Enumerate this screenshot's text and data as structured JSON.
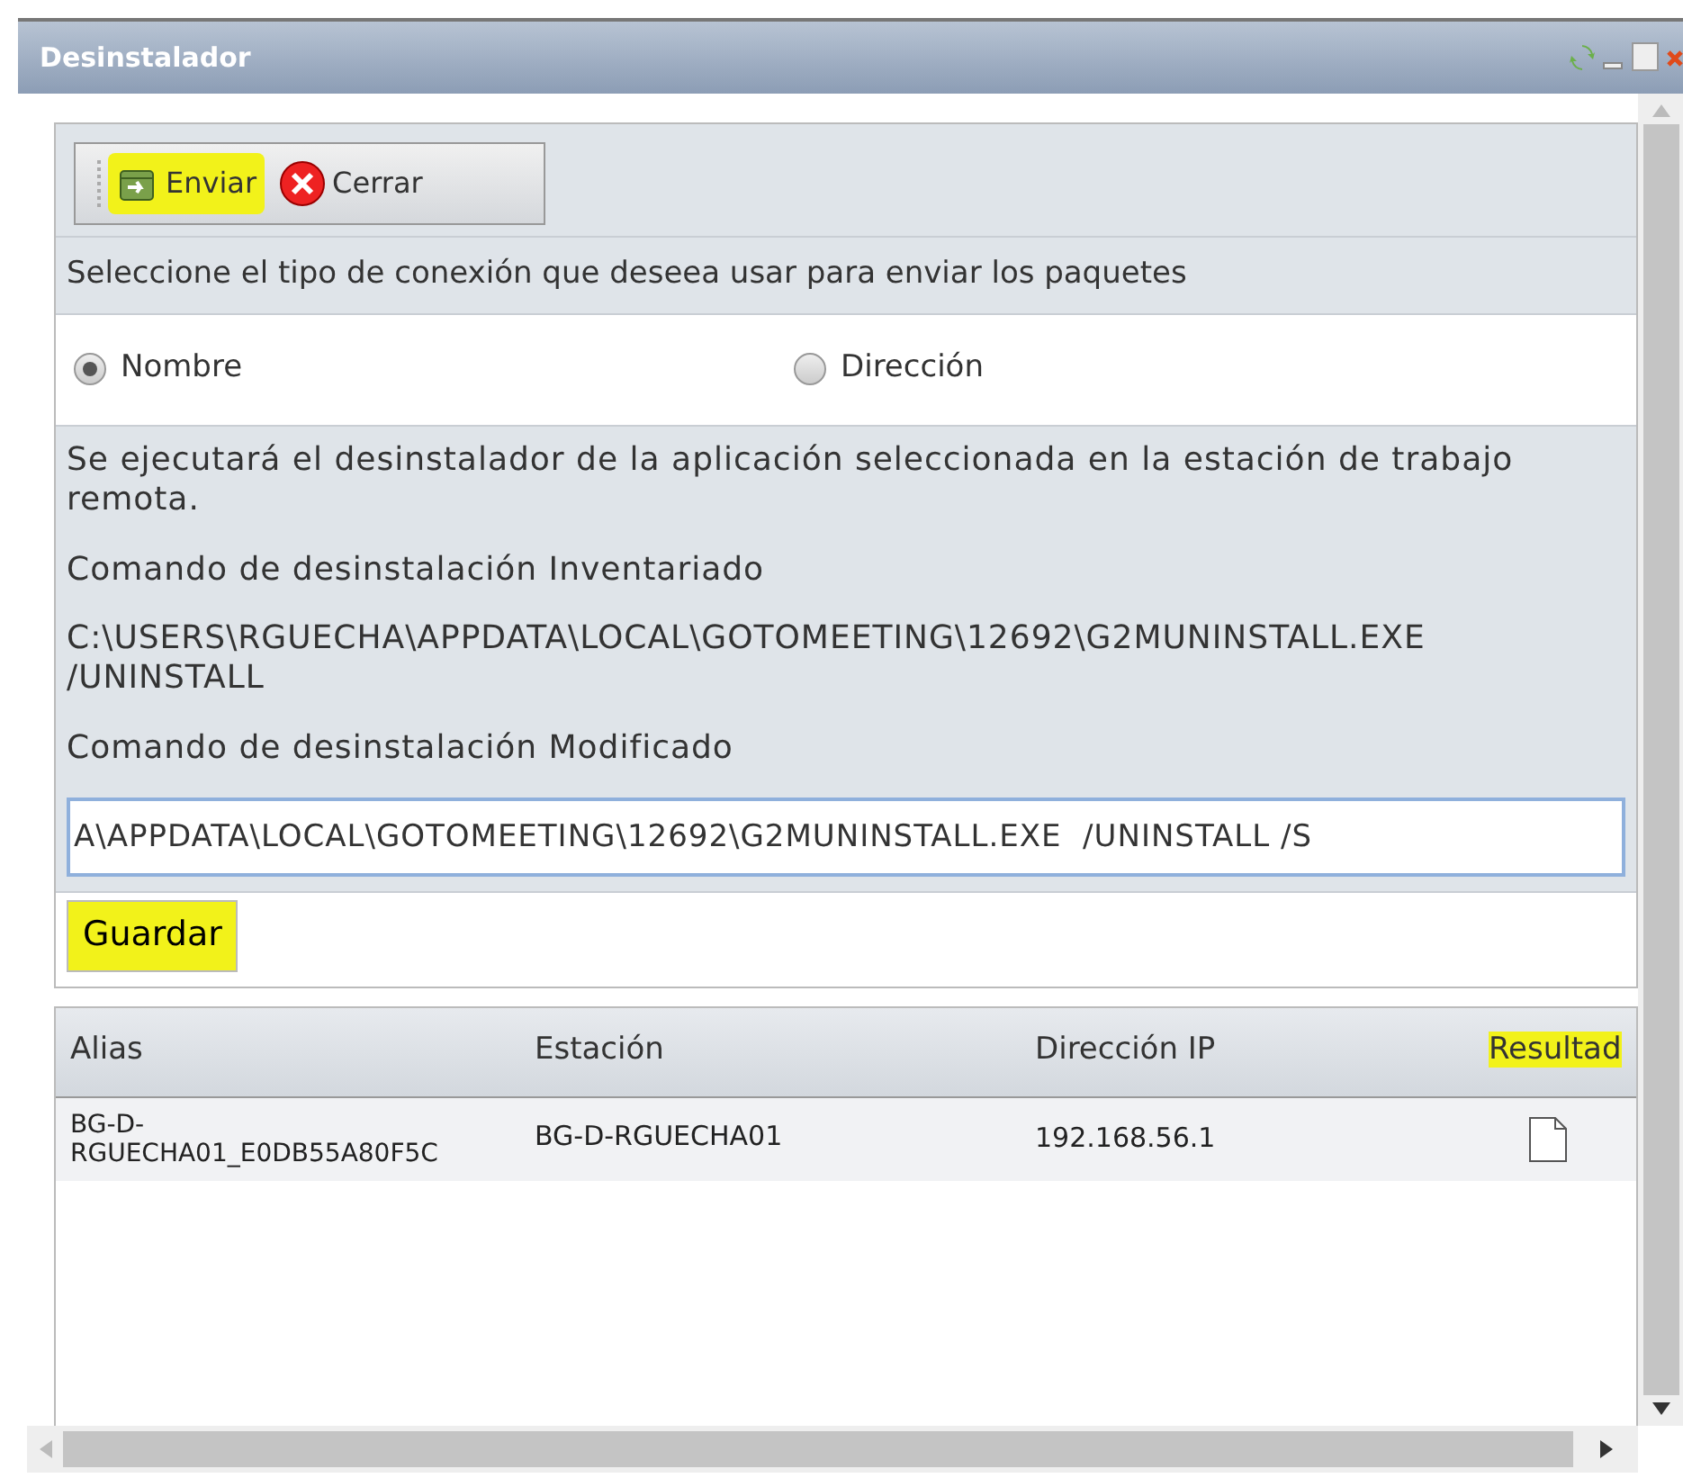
{
  "window": {
    "title": "Desinstalador"
  },
  "toolbar": [
    {
      "kind": "send",
      "label": "Enviar",
      "highlighted": true
    },
    {
      "kind": "close",
      "label": "Cerrar",
      "highlighted": false
    }
  ],
  "connection": {
    "prompt": "Seleccione el tipo de conexión que deseea usar para enviar los paquetes",
    "options": [
      {
        "label": "Nombre",
        "selected": true
      },
      {
        "label": "Dirección",
        "selected": false
      }
    ]
  },
  "info": {
    "description": "Se ejecutará el desinstalador de la aplicación seleccionada en la estación de trabajo remota.",
    "inventoried_label": "Comando de desinstalación Inventariado",
    "inventoried_command": "C:\\USERS\\RGUECHA\\APPDATA\\LOCAL\\GOTOMEETING\\12692\\G2MUNINSTALL.EXE /UNINSTALL",
    "modified_label": "Comando de desinstalación Modificado",
    "modified_command": "A\\APPDATA\\LOCAL\\GOTOMEETING\\12692\\G2MUNINSTALL.EXE  /UNINSTALL /S"
  },
  "save_button": {
    "label": "Guardar",
    "highlighted": true
  },
  "table": {
    "columns": [
      {
        "label": "Alias",
        "highlighted": false
      },
      {
        "label": "Estación",
        "highlighted": false
      },
      {
        "label": "Dirección IP",
        "highlighted": false
      },
      {
        "label": "Resultad",
        "highlighted": true
      }
    ],
    "rows": [
      {
        "alias": "BG-D-RGUECHA01_E0DB55A80F5C",
        "station": "BG-D-RGUECHA01",
        "ip": "192.168.56.1"
      }
    ]
  }
}
